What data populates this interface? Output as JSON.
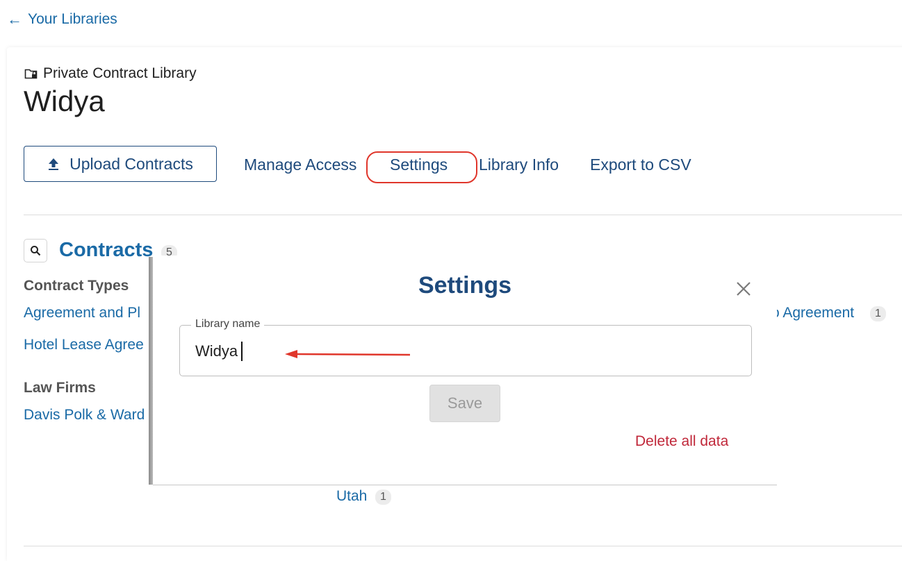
{
  "back_link": {
    "label": "Your Libraries"
  },
  "library": {
    "type_label": "Private Contract Library",
    "name": "Widya"
  },
  "toolbar": {
    "upload_label": "Upload Contracts",
    "manage_access": "Manage Access",
    "settings": "Settings",
    "library_info": "Library Info",
    "export_csv": "Export to CSV"
  },
  "contracts": {
    "title": "Contracts",
    "count": "5",
    "contract_types_heading": "Contract Types",
    "contract_types": [
      {
        "label": "Agreement and Pl",
        "count": ""
      },
      {
        "label": "Hotel Lease Agree",
        "count": ""
      },
      {
        "label": "o Agreement",
        "count": "1"
      }
    ],
    "law_firms_heading": "Law Firms",
    "law_firms": [
      {
        "label": "Davis Polk & Ward",
        "count": ""
      }
    ],
    "states": [
      {
        "label": "Utah",
        "count": "1"
      }
    ]
  },
  "settings_modal": {
    "title": "Settings",
    "field_label": "Library name",
    "field_value": "Widya",
    "save_label": "Save",
    "delete_label": "Delete all data"
  },
  "colors": {
    "link_blue": "#1a6aa6",
    "navy": "#1e4a7c",
    "highlight_red": "#e0362b",
    "danger_red": "#c0283a"
  }
}
